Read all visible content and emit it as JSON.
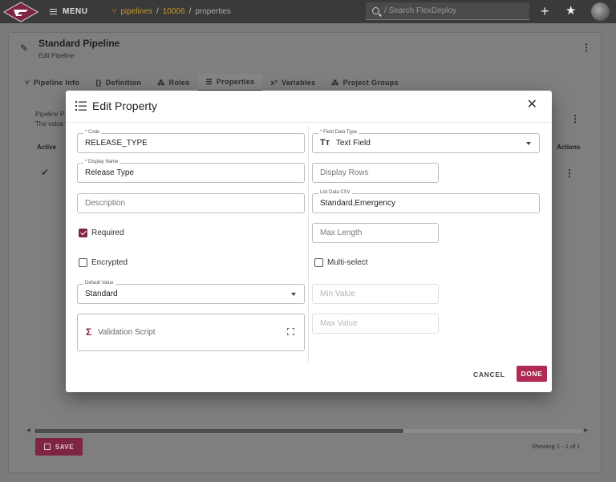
{
  "topbar": {
    "menu_label": "MENU",
    "breadcrumb": [
      "pipelines",
      "10006",
      "properties"
    ],
    "search_placeholder": "/ Search FlexDeploy",
    "accent": "#c39a2a"
  },
  "page": {
    "title": "Standard Pipeline",
    "subtitle": "Edit Pipeline",
    "tabs": [
      {
        "label": "Pipeline Info",
        "icon": "pipeline-icon"
      },
      {
        "label": "Definition",
        "icon": "braces-icon"
      },
      {
        "label": "Roles",
        "icon": "roles-icon"
      },
      {
        "label": "Properties",
        "icon": "list-icon",
        "active": true
      },
      {
        "label": "Variables",
        "icon": "variable-icon"
      },
      {
        "label": "Project Groups",
        "icon": "groups-icon"
      }
    ],
    "desc_line1": "Pipeline P",
    "desc_line2": "The value",
    "col_active": "Active",
    "col_actions": "Actions",
    "save_label": "SAVE",
    "showing": "Showing 1 - 1 of 1"
  },
  "dialog": {
    "title": "Edit Property",
    "code": {
      "label": "* Code",
      "value": "RELEASE_TYPE"
    },
    "display_name": {
      "label": "* Display Name",
      "value": "Release Type"
    },
    "description": {
      "placeholder": "Description"
    },
    "required": {
      "label": "Required",
      "checked": true
    },
    "encrypted": {
      "label": "Encrypted",
      "checked": false
    },
    "default_value": {
      "label": "Default Value",
      "value": "Standard"
    },
    "validation_script": {
      "label": "Validation Script"
    },
    "field_data_type": {
      "label": "* Field Data Type",
      "value": "Text Field"
    },
    "display_rows": {
      "placeholder": "Display Rows"
    },
    "list_data_csv": {
      "label": "List Data CSV",
      "value": "Standard,Emergency"
    },
    "max_length": {
      "placeholder": "Max Length"
    },
    "multi_select": {
      "label": "Multi-select",
      "checked": false
    },
    "min_value": {
      "placeholder": "Min Value"
    },
    "max_value": {
      "placeholder": "Max Value"
    },
    "cancel_label": "CANCEL",
    "done_label": "DONE",
    "accent": "#b02a54"
  }
}
